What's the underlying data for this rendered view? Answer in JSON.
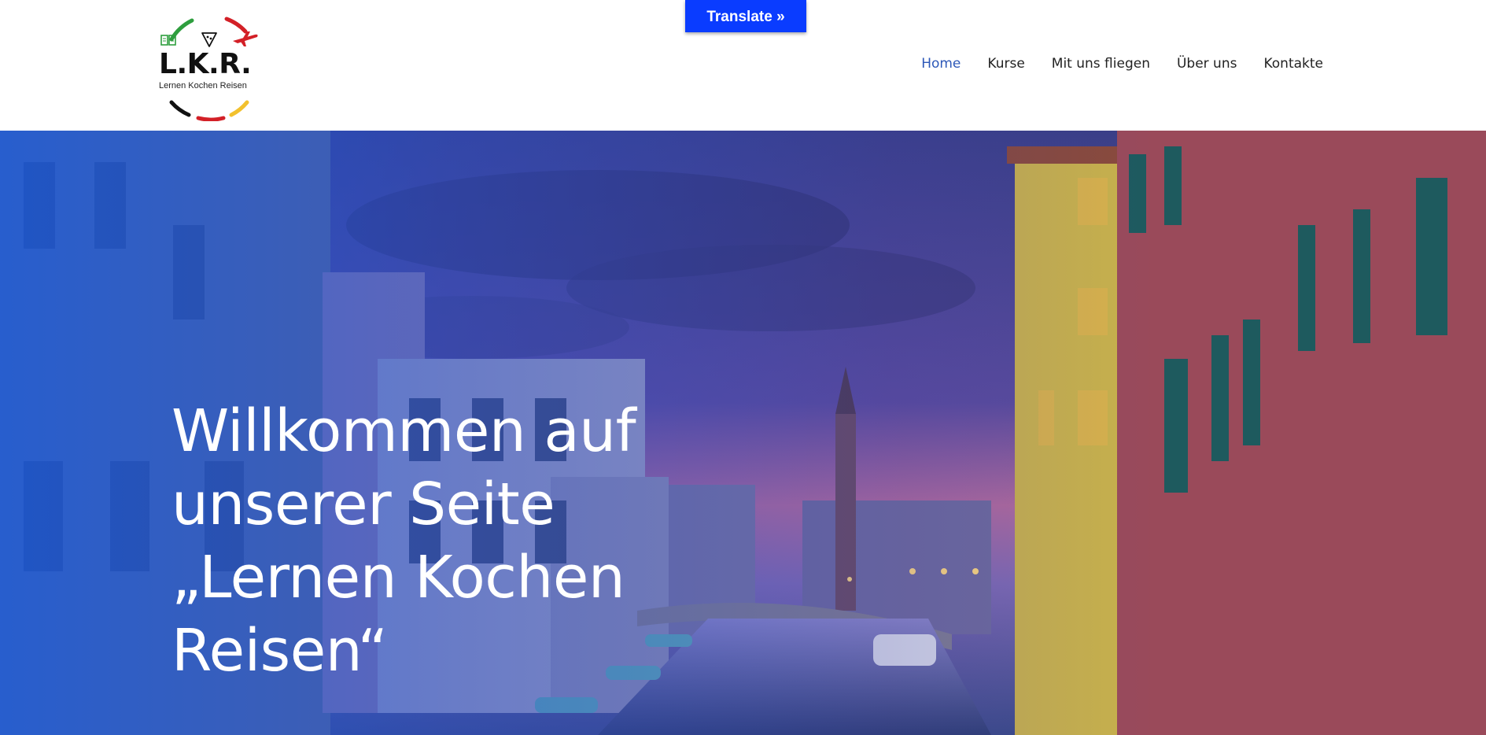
{
  "header": {
    "logo": {
      "letters": "L.K.R.",
      "subtitle": "Lernen Kochen Reisen",
      "colors": [
        "#2e9e3e",
        "#111111",
        "#d32027",
        "#f2c12e"
      ],
      "icons": [
        "book-icon",
        "pizza-icon",
        "airplane-icon"
      ]
    },
    "translate_label": "Translate »",
    "nav": [
      {
        "label": "Home",
        "active": true
      },
      {
        "label": "Kurse",
        "active": false
      },
      {
        "label": "Mit uns fliegen",
        "active": false
      },
      {
        "label": "Über uns",
        "active": false
      },
      {
        "label": "Kontakte",
        "active": false
      }
    ]
  },
  "hero": {
    "title_lines": [
      "Willkommen auf",
      "unserer Seite",
      "„Lernen Kochen",
      "Reisen“"
    ],
    "image": "venice-canal-at-dusk",
    "overlay_color": "#1e5ae6"
  },
  "colors": {
    "accent": "#2d58b8",
    "translate_button": "#0a3cff",
    "nav_text": "#222222"
  }
}
